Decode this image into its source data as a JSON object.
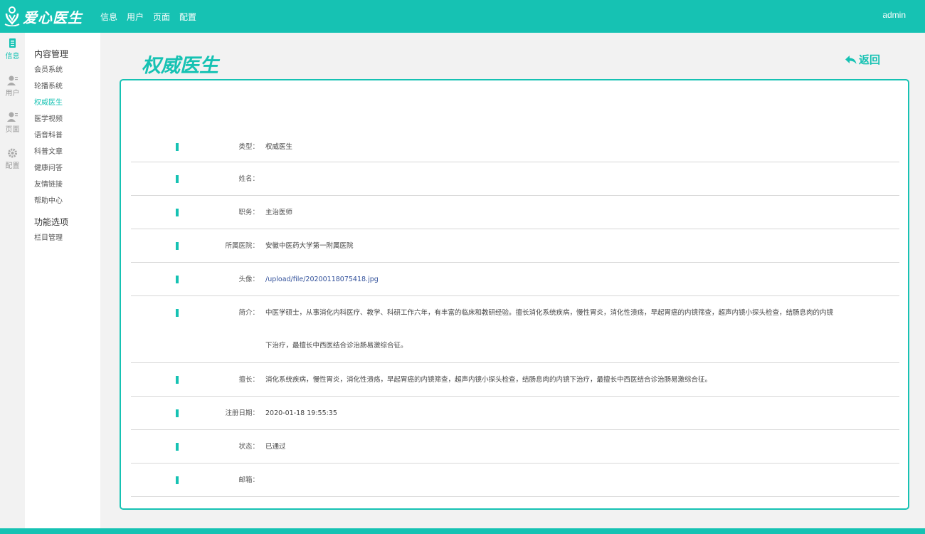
{
  "app": {
    "name": "爱心医生",
    "user": "admin"
  },
  "topnav": [
    "信息",
    "用户",
    "页面",
    "配置"
  ],
  "rail": [
    {
      "icon": "document-icon",
      "label": "信息",
      "active": true
    },
    {
      "icon": "user-icon",
      "label": "用户",
      "active": false
    },
    {
      "icon": "page-icon",
      "label": "页面",
      "active": false
    },
    {
      "icon": "gear-icon",
      "label": "配置",
      "active": false
    }
  ],
  "menu": {
    "group1": "内容管理",
    "items1": [
      "会员系统",
      "轮播系统",
      "权威医生",
      "医学视频",
      "语音科普",
      "科普文章",
      "健康问答",
      "友情链接",
      "帮助中心"
    ],
    "group2": "功能选项",
    "items2": [
      "栏目管理"
    ]
  },
  "page": {
    "title": "权威医生",
    "back_label": "返回"
  },
  "detail": [
    {
      "label": "类型：",
      "value": "权威医生"
    },
    {
      "label": "姓名：",
      "value": ""
    },
    {
      "label": "职务：",
      "value": "主治医师"
    },
    {
      "label": "所属医院：",
      "value": "安徽中医药大学第一附属医院"
    },
    {
      "label": "头像：",
      "value": "/upload/file/20200118075418.jpg"
    },
    {
      "label": "简介：",
      "value": "中医学硕士，从事消化内科医疗、教学、科研工作六年，有丰富的临床和教研经验。擅长消化系统疾病，慢性胃炎，消化性溃疡，早起胃癌的内镜筛查，超声内镜小探头检查，结肠息肉的内镜",
      "value2": "下治疗，最擅长中西医结合诊治肠易激综合征。"
    },
    {
      "label": "擅长：",
      "value": "消化系统疾病，慢性胃炎，消化性溃疡，早起胃癌的内镜筛查，超声内镜小探头检查，结肠息肉的内镜下治疗，最擅长中西医结合诊治肠易激综合征。"
    },
    {
      "label": "注册日期：",
      "value": "2020-01-18 19:55:35"
    },
    {
      "label": "状态：",
      "value": "已通过"
    },
    {
      "label": "邮箱：",
      "value": ""
    }
  ],
  "colors": {
    "accent": "#16c2b3",
    "link": "#31509a"
  }
}
